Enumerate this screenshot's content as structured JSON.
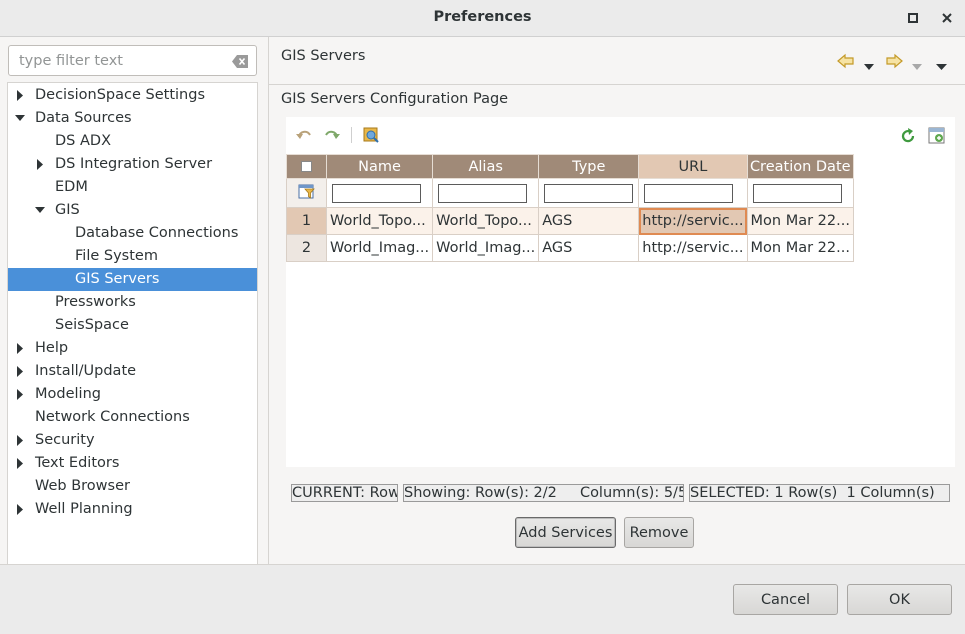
{
  "window": {
    "title": "Preferences"
  },
  "filter": {
    "placeholder": "type filter text",
    "value": ""
  },
  "tree": {
    "items": [
      {
        "label": "DecisionSpace Settings",
        "level": 0,
        "expander": "collapsed"
      },
      {
        "label": "Data Sources",
        "level": 0,
        "expander": "expanded"
      },
      {
        "label": "DS ADX",
        "level": 1,
        "expander": "none"
      },
      {
        "label": "DS Integration Server",
        "level": 1,
        "expander": "collapsed"
      },
      {
        "label": "EDM",
        "level": 1,
        "expander": "none"
      },
      {
        "label": "GIS",
        "level": 1,
        "expander": "expanded"
      },
      {
        "label": "Database Connections",
        "level": 2,
        "expander": "none"
      },
      {
        "label": "File System",
        "level": 2,
        "expander": "none"
      },
      {
        "label": "GIS Servers",
        "level": 2,
        "expander": "none",
        "selected": true
      },
      {
        "label": "Pressworks",
        "level": 1,
        "expander": "none"
      },
      {
        "label": "SeisSpace",
        "level": 1,
        "expander": "none"
      },
      {
        "label": "Help",
        "level": 0,
        "expander": "collapsed"
      },
      {
        "label": "Install/Update",
        "level": 0,
        "expander": "collapsed"
      },
      {
        "label": "Modeling",
        "level": 0,
        "expander": "collapsed"
      },
      {
        "label": "Network Connections",
        "level": 0,
        "expander": "none"
      },
      {
        "label": "Security",
        "level": 0,
        "expander": "collapsed"
      },
      {
        "label": "Text Editors",
        "level": 0,
        "expander": "collapsed"
      },
      {
        "label": "Web Browser",
        "level": 0,
        "expander": "none"
      },
      {
        "label": "Well Planning",
        "level": 0,
        "expander": "collapsed"
      }
    ]
  },
  "page": {
    "title": "GIS Servers",
    "description": "GIS Servers Configuration Page"
  },
  "grid": {
    "columns": [
      "Name",
      "Alias",
      "Type",
      "URL",
      "Creation Date"
    ],
    "selected_column": "URL",
    "rows": [
      {
        "num": "1",
        "cells": [
          "World_Topo...",
          "World_Topo...",
          "AGS",
          "http://servic...",
          "Mon Mar 22..."
        ],
        "selected": true
      },
      {
        "num": "2",
        "cells": [
          "World_Imag...",
          "World_Imag...",
          "AGS",
          "http://servic...",
          "Mon Mar 22..."
        ],
        "selected": false
      }
    ]
  },
  "status": {
    "current": "CURRENT: Row",
    "showing": "Showing: Row(s): 2/2     Column(s): 5/5",
    "selected": "SELECTED: 1 Row(s)  1 Column(s)"
  },
  "buttons": {
    "add_services": "Add Services",
    "remove": "Remove",
    "cancel": "Cancel",
    "ok": "OK"
  },
  "colors": {
    "selection_blue": "#4a90d9",
    "header_brown": "#a08a78",
    "selected_header": "#e2c8b3",
    "cell_outline": "#df8a52"
  }
}
